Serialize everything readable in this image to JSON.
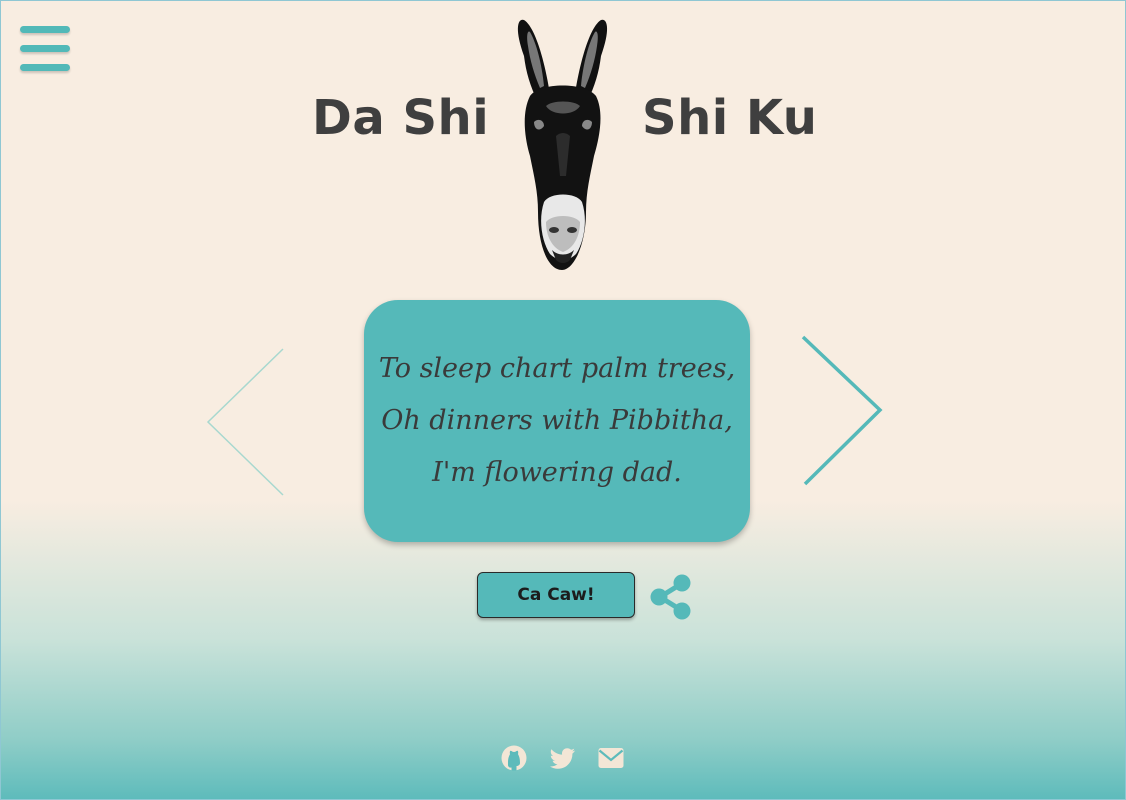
{
  "header": {
    "title_left": "Da Shi",
    "title_right": "Shi Ku",
    "logo_icon": "donkey-head-logo",
    "menu_icon": "hamburger-menu-icon"
  },
  "poem": {
    "lines": [
      "To sleep chart palm trees,",
      "Oh dinners with Pibbitha,",
      "I'm flowering dad."
    ]
  },
  "carousel": {
    "prev_icon": "chevron-left-icon",
    "next_icon": "chevron-right-icon"
  },
  "actions": {
    "generate_label": "Ca Caw!",
    "share_icon": "share-icon"
  },
  "footer": {
    "links": [
      "github-icon",
      "twitter-icon",
      "email-icon"
    ]
  },
  "colors": {
    "accent": "#55b9b9",
    "background_top": "#f8ede1",
    "background_bottom": "#5dbbbb",
    "title_text": "#3f3f3f"
  }
}
